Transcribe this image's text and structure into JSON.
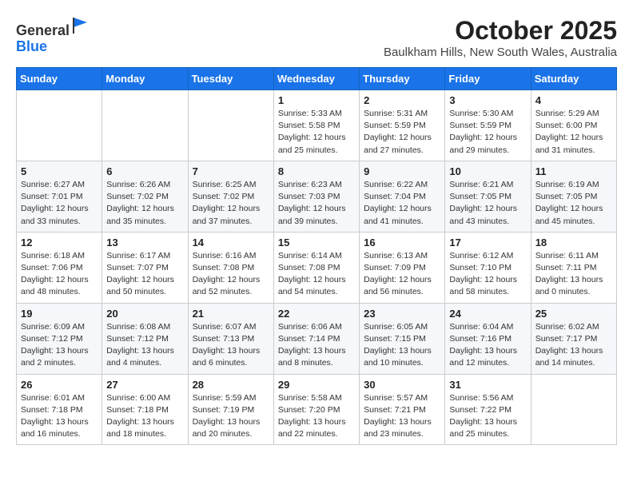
{
  "header": {
    "logo_line1": "General",
    "logo_line2": "Blue",
    "month": "October 2025",
    "location": "Baulkham Hills, New South Wales, Australia"
  },
  "weekdays": [
    "Sunday",
    "Monday",
    "Tuesday",
    "Wednesday",
    "Thursday",
    "Friday",
    "Saturday"
  ],
  "weeks": [
    [
      {
        "day": "",
        "info": ""
      },
      {
        "day": "",
        "info": ""
      },
      {
        "day": "",
        "info": ""
      },
      {
        "day": "1",
        "info": "Sunrise: 5:33 AM\nSunset: 5:58 PM\nDaylight: 12 hours\nand 25 minutes."
      },
      {
        "day": "2",
        "info": "Sunrise: 5:31 AM\nSunset: 5:59 PM\nDaylight: 12 hours\nand 27 minutes."
      },
      {
        "day": "3",
        "info": "Sunrise: 5:30 AM\nSunset: 5:59 PM\nDaylight: 12 hours\nand 29 minutes."
      },
      {
        "day": "4",
        "info": "Sunrise: 5:29 AM\nSunset: 6:00 PM\nDaylight: 12 hours\nand 31 minutes."
      }
    ],
    [
      {
        "day": "5",
        "info": "Sunrise: 6:27 AM\nSunset: 7:01 PM\nDaylight: 12 hours\nand 33 minutes."
      },
      {
        "day": "6",
        "info": "Sunrise: 6:26 AM\nSunset: 7:02 PM\nDaylight: 12 hours\nand 35 minutes."
      },
      {
        "day": "7",
        "info": "Sunrise: 6:25 AM\nSunset: 7:02 PM\nDaylight: 12 hours\nand 37 minutes."
      },
      {
        "day": "8",
        "info": "Sunrise: 6:23 AM\nSunset: 7:03 PM\nDaylight: 12 hours\nand 39 minutes."
      },
      {
        "day": "9",
        "info": "Sunrise: 6:22 AM\nSunset: 7:04 PM\nDaylight: 12 hours\nand 41 minutes."
      },
      {
        "day": "10",
        "info": "Sunrise: 6:21 AM\nSunset: 7:05 PM\nDaylight: 12 hours\nand 43 minutes."
      },
      {
        "day": "11",
        "info": "Sunrise: 6:19 AM\nSunset: 7:05 PM\nDaylight: 12 hours\nand 45 minutes."
      }
    ],
    [
      {
        "day": "12",
        "info": "Sunrise: 6:18 AM\nSunset: 7:06 PM\nDaylight: 12 hours\nand 48 minutes."
      },
      {
        "day": "13",
        "info": "Sunrise: 6:17 AM\nSunset: 7:07 PM\nDaylight: 12 hours\nand 50 minutes."
      },
      {
        "day": "14",
        "info": "Sunrise: 6:16 AM\nSunset: 7:08 PM\nDaylight: 12 hours\nand 52 minutes."
      },
      {
        "day": "15",
        "info": "Sunrise: 6:14 AM\nSunset: 7:08 PM\nDaylight: 12 hours\nand 54 minutes."
      },
      {
        "day": "16",
        "info": "Sunrise: 6:13 AM\nSunset: 7:09 PM\nDaylight: 12 hours\nand 56 minutes."
      },
      {
        "day": "17",
        "info": "Sunrise: 6:12 AM\nSunset: 7:10 PM\nDaylight: 12 hours\nand 58 minutes."
      },
      {
        "day": "18",
        "info": "Sunrise: 6:11 AM\nSunset: 7:11 PM\nDaylight: 13 hours\nand 0 minutes."
      }
    ],
    [
      {
        "day": "19",
        "info": "Sunrise: 6:09 AM\nSunset: 7:12 PM\nDaylight: 13 hours\nand 2 minutes."
      },
      {
        "day": "20",
        "info": "Sunrise: 6:08 AM\nSunset: 7:12 PM\nDaylight: 13 hours\nand 4 minutes."
      },
      {
        "day": "21",
        "info": "Sunrise: 6:07 AM\nSunset: 7:13 PM\nDaylight: 13 hours\nand 6 minutes."
      },
      {
        "day": "22",
        "info": "Sunrise: 6:06 AM\nSunset: 7:14 PM\nDaylight: 13 hours\nand 8 minutes."
      },
      {
        "day": "23",
        "info": "Sunrise: 6:05 AM\nSunset: 7:15 PM\nDaylight: 13 hours\nand 10 minutes."
      },
      {
        "day": "24",
        "info": "Sunrise: 6:04 AM\nSunset: 7:16 PM\nDaylight: 13 hours\nand 12 minutes."
      },
      {
        "day": "25",
        "info": "Sunrise: 6:02 AM\nSunset: 7:17 PM\nDaylight: 13 hours\nand 14 minutes."
      }
    ],
    [
      {
        "day": "26",
        "info": "Sunrise: 6:01 AM\nSunset: 7:18 PM\nDaylight: 13 hours\nand 16 minutes."
      },
      {
        "day": "27",
        "info": "Sunrise: 6:00 AM\nSunset: 7:18 PM\nDaylight: 13 hours\nand 18 minutes."
      },
      {
        "day": "28",
        "info": "Sunrise: 5:59 AM\nSunset: 7:19 PM\nDaylight: 13 hours\nand 20 minutes."
      },
      {
        "day": "29",
        "info": "Sunrise: 5:58 AM\nSunset: 7:20 PM\nDaylight: 13 hours\nand 22 minutes."
      },
      {
        "day": "30",
        "info": "Sunrise: 5:57 AM\nSunset: 7:21 PM\nDaylight: 13 hours\nand 23 minutes."
      },
      {
        "day": "31",
        "info": "Sunrise: 5:56 AM\nSunset: 7:22 PM\nDaylight: 13 hours\nand 25 minutes."
      },
      {
        "day": "",
        "info": ""
      }
    ]
  ]
}
